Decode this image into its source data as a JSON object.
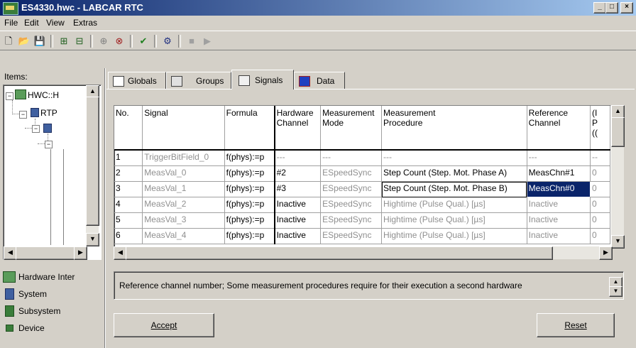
{
  "window": {
    "title": "ES4330.hwc - LABCAR RTC",
    "min": "_",
    "max": "□",
    "close": "×"
  },
  "menu": [
    "File",
    "Edit",
    "View",
    "Extras"
  ],
  "left": {
    "items_label": "Items:",
    "tree": [
      {
        "label": "HWC::H"
      },
      {
        "label": "RTP"
      }
    ],
    "legend": [
      {
        "label": "Hardware Inter",
        "icon": "hardware-interface-icon"
      },
      {
        "label": "System",
        "icon": "system-icon"
      },
      {
        "label": "Subsystem",
        "icon": "subsystem-icon"
      },
      {
        "label": "Device",
        "icon": "device-icon"
      }
    ]
  },
  "tabs": [
    {
      "label": "Globals",
      "icon": "globals-icon",
      "active": false
    },
    {
      "label": "Groups",
      "icon": "groups-icon",
      "active": false
    },
    {
      "label": "Signals",
      "icon": "signals-icon",
      "active": true
    },
    {
      "label": "Data",
      "icon": "data-icon",
      "active": false
    }
  ],
  "grid": {
    "headers": [
      [
        "No."
      ],
      [
        "Signal"
      ],
      [
        "Formula"
      ],
      [
        "Hardware",
        "Channel"
      ],
      [
        "Measurement",
        "Mode"
      ],
      [
        "Measurement",
        "Procedure"
      ],
      [
        "Reference",
        "Channel"
      ],
      [
        "(I",
        "P",
        "(("
      ]
    ],
    "rows": [
      [
        "1",
        "TriggerBitField_0",
        "f(phys):=p",
        "---",
        "---",
        "---",
        "---",
        "--"
      ],
      [
        "2",
        "MeasVal_0",
        "f(phys):=p",
        "#2",
        "ESpeedSync",
        "Step Count (Step. Mot. Phase A)",
        "MeasChn#1",
        "0"
      ],
      [
        "3",
        "MeasVal_1",
        "f(phys):=p",
        "#3",
        "ESpeedSync",
        "Step Count (Step. Mot. Phase B)",
        "MeasChn#0",
        "0"
      ],
      [
        "4",
        "MeasVal_2",
        "f(phys):=p",
        "Inactive",
        "ESpeedSync",
        "Hightime (Pulse Qual.) [µs]",
        "Inactive",
        "0"
      ],
      [
        "5",
        "MeasVal_3",
        "f(phys):=p",
        "Inactive",
        "ESpeedSync",
        "Hightime (Pulse Qual.) [µs]",
        "Inactive",
        "0"
      ],
      [
        "6",
        "MeasVal_4",
        "f(phys):=p",
        "Inactive",
        "ESpeedSync",
        "Hightime (Pulse Qual.) [µs]",
        "Inactive",
        "0"
      ]
    ]
  },
  "description": "Reference channel number; Some measurement procedures require for their execution a second hardware",
  "buttons": {
    "accept": "Accept",
    "reset": "Reset"
  },
  "colors": {
    "selection": "#0a246a",
    "face": "#d4d0c8",
    "title_start": "#0a246a",
    "title_end": "#a6caf0"
  }
}
